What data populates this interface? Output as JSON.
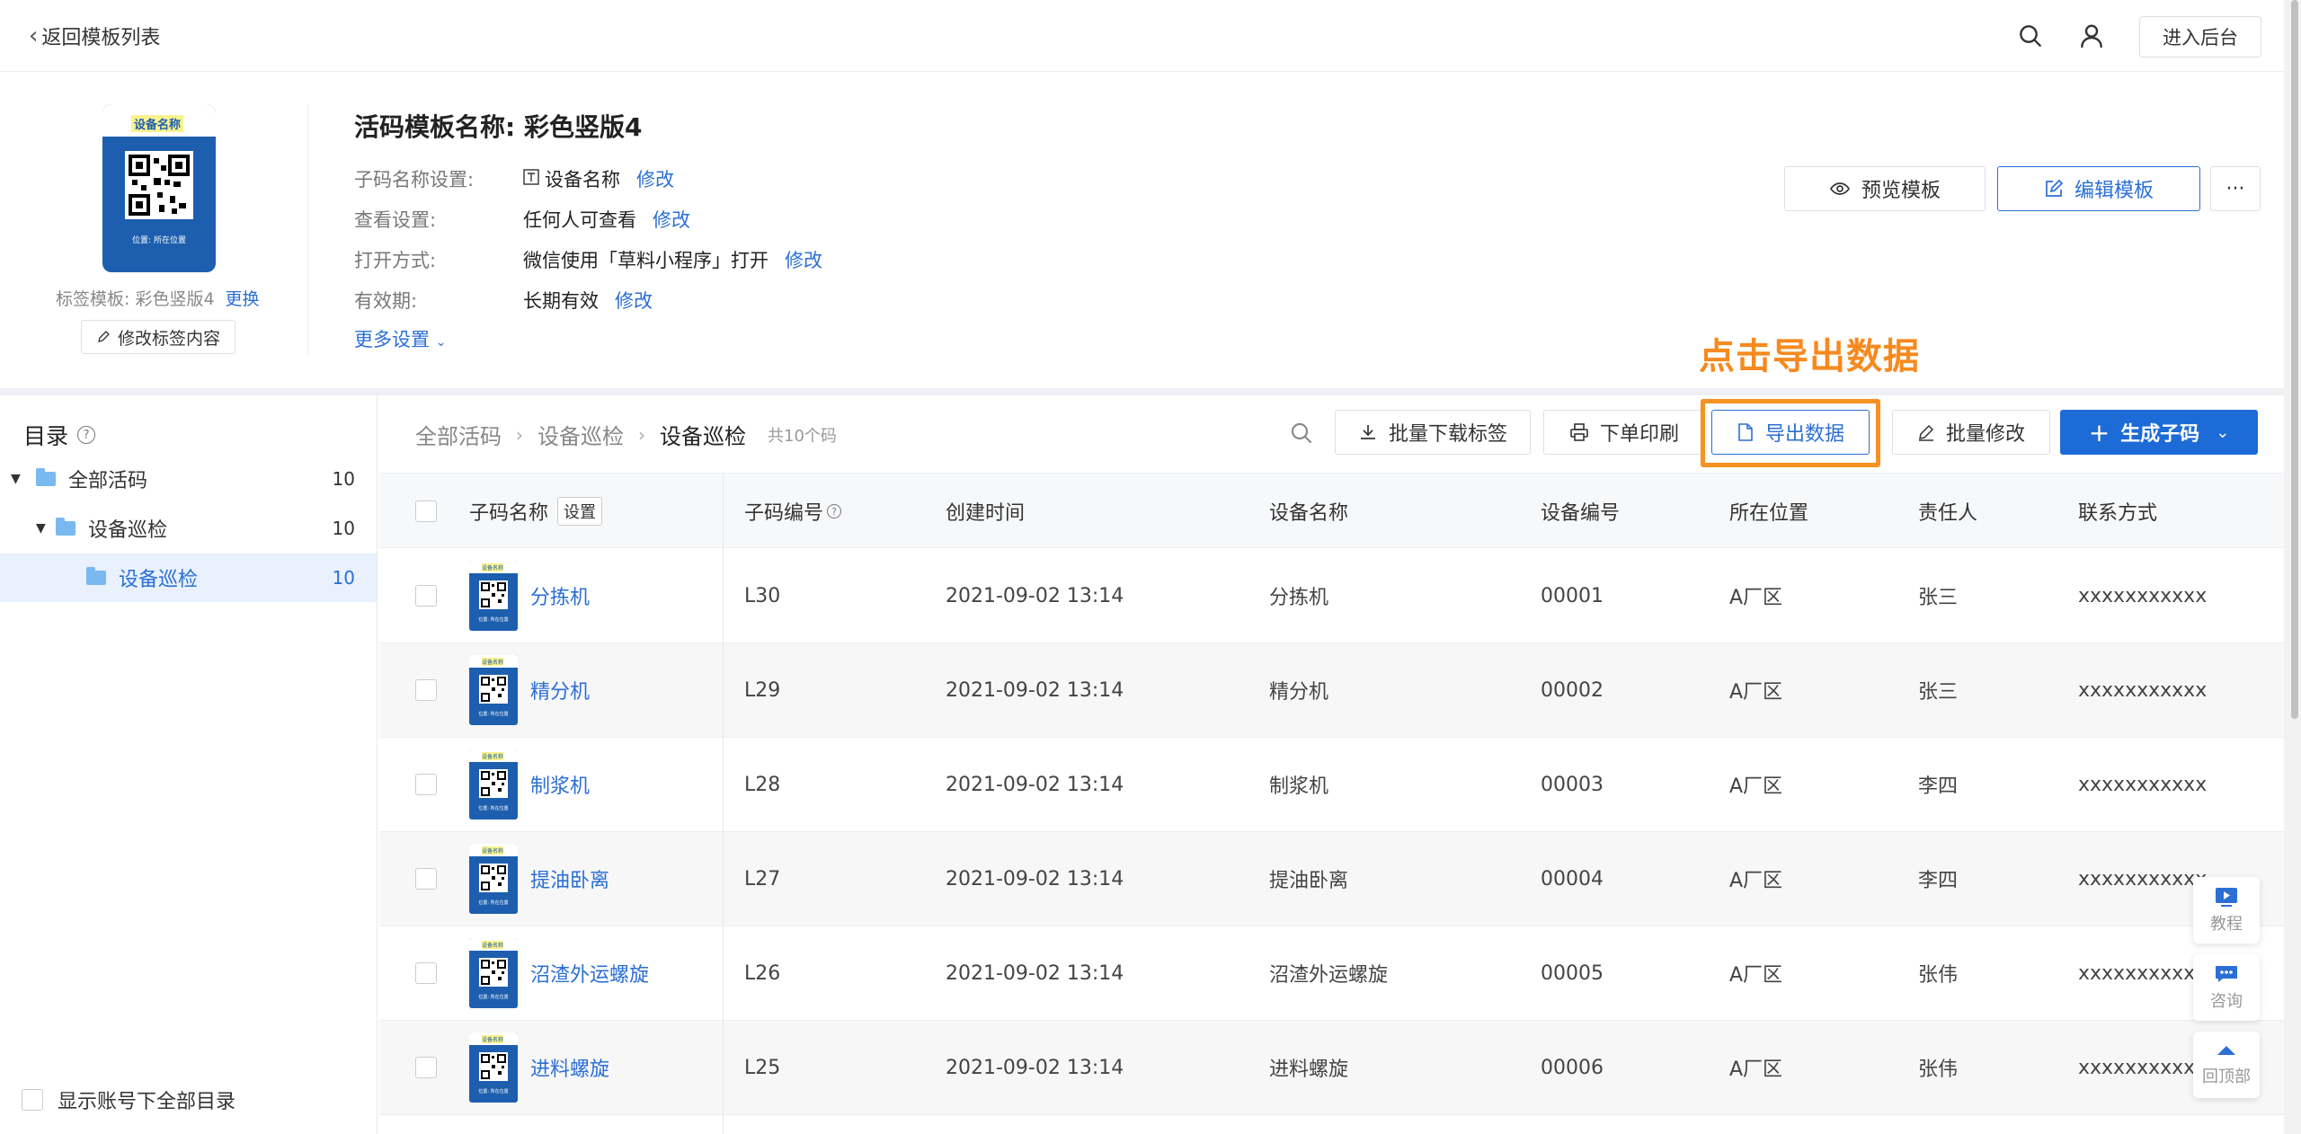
{
  "topbar": {
    "back_label": "返回模板列表",
    "backend_label": "进入后台"
  },
  "template": {
    "thumb_title": "设备名称",
    "thumb_footer": "位置: 所在位置",
    "label_template_text": "标签模板: 彩色竖版4",
    "change_label": "更换",
    "edit_label_btn": "修改标签内容",
    "name": "活码模板名称: 彩色竖版4",
    "settings": [
      {
        "label": "子码名称设置:",
        "value": "设备名称",
        "action": "修改"
      },
      {
        "label": "查看设置:",
        "value": "任何人可查看",
        "action": "修改"
      },
      {
        "label": "打开方式:",
        "value": "微信使用「草料小程序」打开",
        "action": "修改"
      },
      {
        "label": "有效期:",
        "value": "长期有效",
        "action": "修改"
      }
    ],
    "more_settings": "更多设置",
    "preview_btn": "预览模板",
    "edit_btn": "编辑模板",
    "more_btn": "···"
  },
  "sidebar": {
    "title": "目录",
    "tree": [
      {
        "label": "全部活码",
        "count": "10"
      },
      {
        "label": "设备巡检",
        "count": "10"
      },
      {
        "label": "设备巡检",
        "count": "10"
      }
    ],
    "show_all": "显示账号下全部目录"
  },
  "main": {
    "breadcrumb": [
      "全部活码",
      "设备巡检",
      "设备巡检"
    ],
    "total": "共10个码",
    "buttons": {
      "batch_download": "批量下载标签",
      "print": "下单印刷",
      "export": "导出数据",
      "batch_edit": "批量修改",
      "generate": "生成子码"
    },
    "annotation": "点击导出数据",
    "columns": [
      "子码名称",
      "子码编号",
      "创建时间",
      "设备名称",
      "设备编号",
      "所在位置",
      "责任人",
      "联系方式"
    ],
    "column_setting": "设置",
    "rows": [
      {
        "name": "分拣机",
        "code": "L30",
        "time": "2021-09-02 13:14",
        "device": "分拣机",
        "device_no": "00001",
        "location": "A厂区",
        "owner": "张三",
        "contact": "xxxxxxxxxxx"
      },
      {
        "name": "精分机",
        "code": "L29",
        "time": "2021-09-02 13:14",
        "device": "精分机",
        "device_no": "00002",
        "location": "A厂区",
        "owner": "张三",
        "contact": "xxxxxxxxxxx"
      },
      {
        "name": "制浆机",
        "code": "L28",
        "time": "2021-09-02 13:14",
        "device": "制浆机",
        "device_no": "00003",
        "location": "A厂区",
        "owner": "李四",
        "contact": "xxxxxxxxxxx"
      },
      {
        "name": "提油卧离",
        "code": "L27",
        "time": "2021-09-02 13:14",
        "device": "提油卧离",
        "device_no": "00004",
        "location": "A厂区",
        "owner": "李四",
        "contact": "xxxxxxxxxxx"
      },
      {
        "name": "沼渣外运螺旋",
        "code": "L26",
        "time": "2021-09-02 13:14",
        "device": "沼渣外运螺旋",
        "device_no": "00005",
        "location": "A厂区",
        "owner": "张伟",
        "contact": "xxxxxxxxxxx"
      },
      {
        "name": "进料螺旋",
        "code": "L25",
        "time": "2021-09-02 13:14",
        "device": "进料螺旋",
        "device_no": "00006",
        "location": "A厂区",
        "owner": "张伟",
        "contact": "xxxxxxxxxxx"
      }
    ],
    "mini_card_title": "设备名称",
    "mini_card_footer": "位置: 所在位置"
  },
  "floating": {
    "tutorial": "教程",
    "consult": "咨询",
    "back_top": "回顶部"
  },
  "colors": {
    "accent": "#2b6fd4",
    "primary_button": "#1d6bd6",
    "highlight": "#f59220",
    "card_blue": "#1d5fae"
  }
}
